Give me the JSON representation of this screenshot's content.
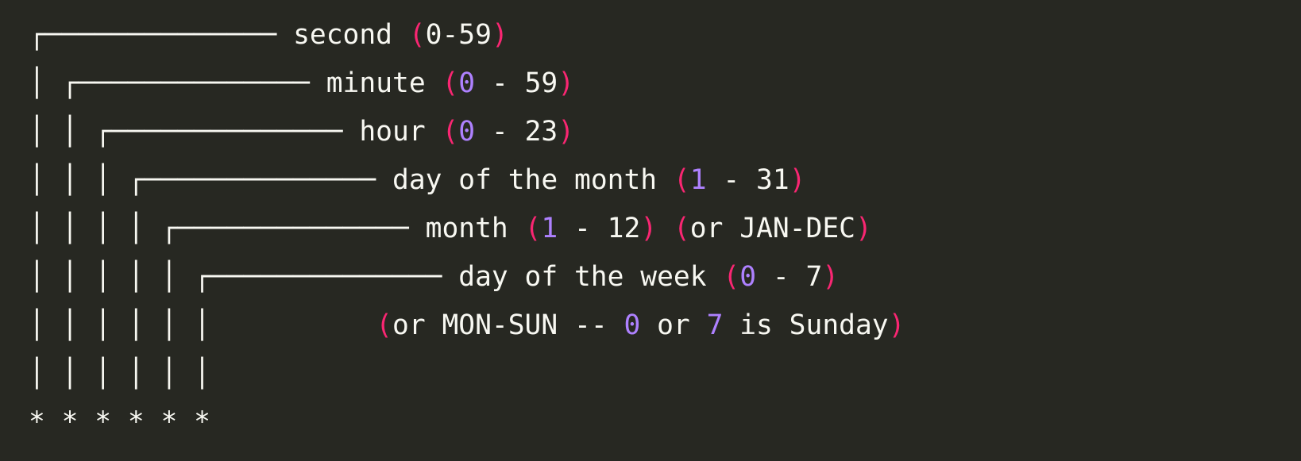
{
  "colors": {
    "background": "#272822",
    "text": "#f8f8f2",
    "paren": "#f92672",
    "number": "#ae81ff"
  },
  "lines": [
    [
      {
        "t": "┌────────────── ",
        "k": "box"
      },
      {
        "t": "second ",
        "k": "text"
      },
      {
        "t": "(",
        "k": "paren"
      },
      {
        "t": "0-59",
        "k": "text"
      },
      {
        "t": ")",
        "k": "paren"
      }
    ],
    [
      {
        "t": "│ ┌────────────── ",
        "k": "box"
      },
      {
        "t": "minute ",
        "k": "text"
      },
      {
        "t": "(",
        "k": "paren"
      },
      {
        "t": "0",
        "k": "num"
      },
      {
        "t": " - 59",
        "k": "text"
      },
      {
        "t": ")",
        "k": "paren"
      }
    ],
    [
      {
        "t": "│ │ ┌────────────── ",
        "k": "box"
      },
      {
        "t": "hour ",
        "k": "text"
      },
      {
        "t": "(",
        "k": "paren"
      },
      {
        "t": "0",
        "k": "num"
      },
      {
        "t": " - 23",
        "k": "text"
      },
      {
        "t": ")",
        "k": "paren"
      }
    ],
    [
      {
        "t": "│ │ │ ┌────────────── ",
        "k": "box"
      },
      {
        "t": "day of the month ",
        "k": "text"
      },
      {
        "t": "(",
        "k": "paren"
      },
      {
        "t": "1",
        "k": "num"
      },
      {
        "t": " - 31",
        "k": "text"
      },
      {
        "t": ")",
        "k": "paren"
      }
    ],
    [
      {
        "t": "│ │ │ │ ┌────────────── ",
        "k": "box"
      },
      {
        "t": "month ",
        "k": "text"
      },
      {
        "t": "(",
        "k": "paren"
      },
      {
        "t": "1",
        "k": "num"
      },
      {
        "t": " - 12",
        "k": "text"
      },
      {
        "t": ")",
        "k": "paren"
      },
      {
        "t": " ",
        "k": "text"
      },
      {
        "t": "(",
        "k": "paren"
      },
      {
        "t": "or JAN-DEC",
        "k": "text"
      },
      {
        "t": ")",
        "k": "paren"
      }
    ],
    [
      {
        "t": "│ │ │ │ │ ┌────────────── ",
        "k": "box"
      },
      {
        "t": "day of the week ",
        "k": "text"
      },
      {
        "t": "(",
        "k": "paren"
      },
      {
        "t": "0",
        "k": "num"
      },
      {
        "t": " - 7",
        "k": "text"
      },
      {
        "t": ")",
        "k": "paren"
      }
    ],
    [
      {
        "t": "│ │ │ │ │ │          ",
        "k": "box"
      },
      {
        "t": "(",
        "k": "paren"
      },
      {
        "t": "or MON-SUN -- ",
        "k": "text"
      },
      {
        "t": "0",
        "k": "num"
      },
      {
        "t": " or ",
        "k": "text"
      },
      {
        "t": "7",
        "k": "num"
      },
      {
        "t": " is Sunday",
        "k": "text"
      },
      {
        "t": ")",
        "k": "paren"
      }
    ],
    [
      {
        "t": "│ │ │ │ │ │",
        "k": "box"
      }
    ],
    [
      {
        "t": "* * * * * *",
        "k": "text"
      }
    ]
  ]
}
